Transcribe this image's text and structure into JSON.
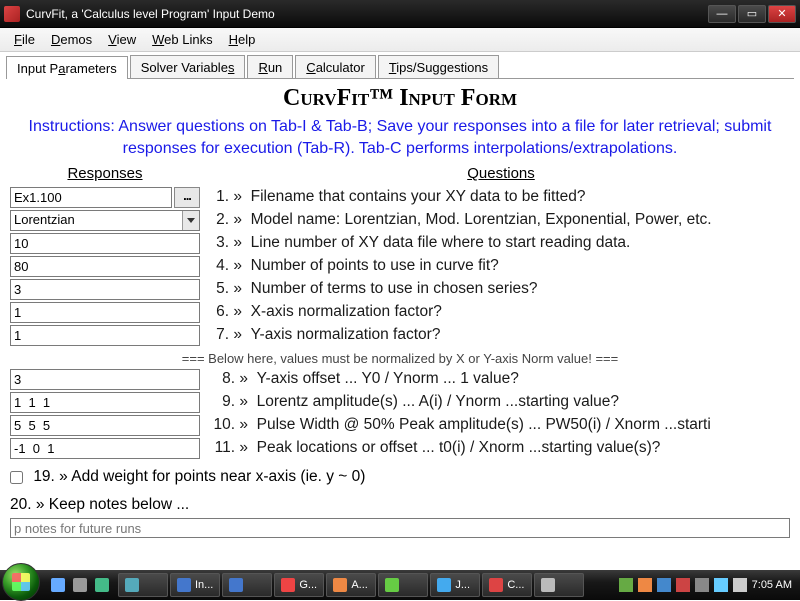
{
  "window": {
    "title": "CurvFit, a 'Calculus level Program' Input Demo"
  },
  "menu": {
    "file": "File",
    "demos": "Demos",
    "view": "View",
    "weblinks": "Web Links",
    "help": "Help"
  },
  "tabs": {
    "input": "Input Parameters",
    "solver": "Solver Variables",
    "run": "Run",
    "calc": "Calculator",
    "tips": "Tips/Suggestions"
  },
  "form": {
    "heading_a": "C",
    "heading_b": "urv",
    "heading_c": "F",
    "heading_d": "it™ Input Form",
    "instructions": "Instructions: Answer questions on Tab-I & Tab-B; Save your responses into a file for later retrieval; submit responses for execution (Tab-R). Tab-C performs interpolations/extrapolations.",
    "responses_label": "Responses",
    "questions_label": "Questions",
    "r1": "Ex1.100",
    "browse_btn": "...",
    "r2": "Lorentzian",
    "r3": "10",
    "r4": "80",
    "r5": "3",
    "r6": "1",
    "r7": "1",
    "q1": "Filename that contains your XY data to be fitted?",
    "q2": "Model name: Lorentzian, Mod. Lorentzian, Exponential, Power, etc.",
    "q3": "Line number of XY data file where to start reading data.",
    "q4": "Number of points to use in curve fit?",
    "q5": "Number of terms to use in chosen series?",
    "q6": "X-axis normalization factor?",
    "q7": "Y-axis normalization factor?",
    "divider": "=== Below here, values must be normalized by X or Y-axis Norm value! ===",
    "r8": "3",
    "r9": "1  1  1",
    "r10": "5  5  5",
    "r11": "-1  0  1",
    "q8": "Y-axis offset ... Y0 / Ynorm ... 1 value?",
    "q9": "Lorentz amplitude(s) ... A(i) / Ynorm ...starting value?",
    "q10": "Pulse Width @ 50% Peak amplitude(s) ... PW50(i) / Xnorm ...starti",
    "q11": "Peak locations or offset ... t0(i) / Xnorm ...starting value(s)?",
    "q19": "19. »  Add weight for points near x-axis (ie. y ~ 0)",
    "q20": "20. »  Keep notes below ...",
    "notes_placeholder": "p notes for future runs"
  },
  "taskbar": {
    "items": [
      {
        "label": "",
        "color": "#5ab"
      },
      {
        "label": "In...",
        "color": "#47c"
      },
      {
        "label": "",
        "color": "#47c"
      },
      {
        "label": "G...",
        "color": "#e44"
      },
      {
        "label": "A...",
        "color": "#e84"
      },
      {
        "label": "",
        "color": "#6c4"
      },
      {
        "label": "J...",
        "color": "#4ae"
      },
      {
        "label": "C...",
        "color": "#d44"
      },
      {
        "label": "",
        "color": "#bbb"
      }
    ],
    "clock": "7:05 AM"
  }
}
